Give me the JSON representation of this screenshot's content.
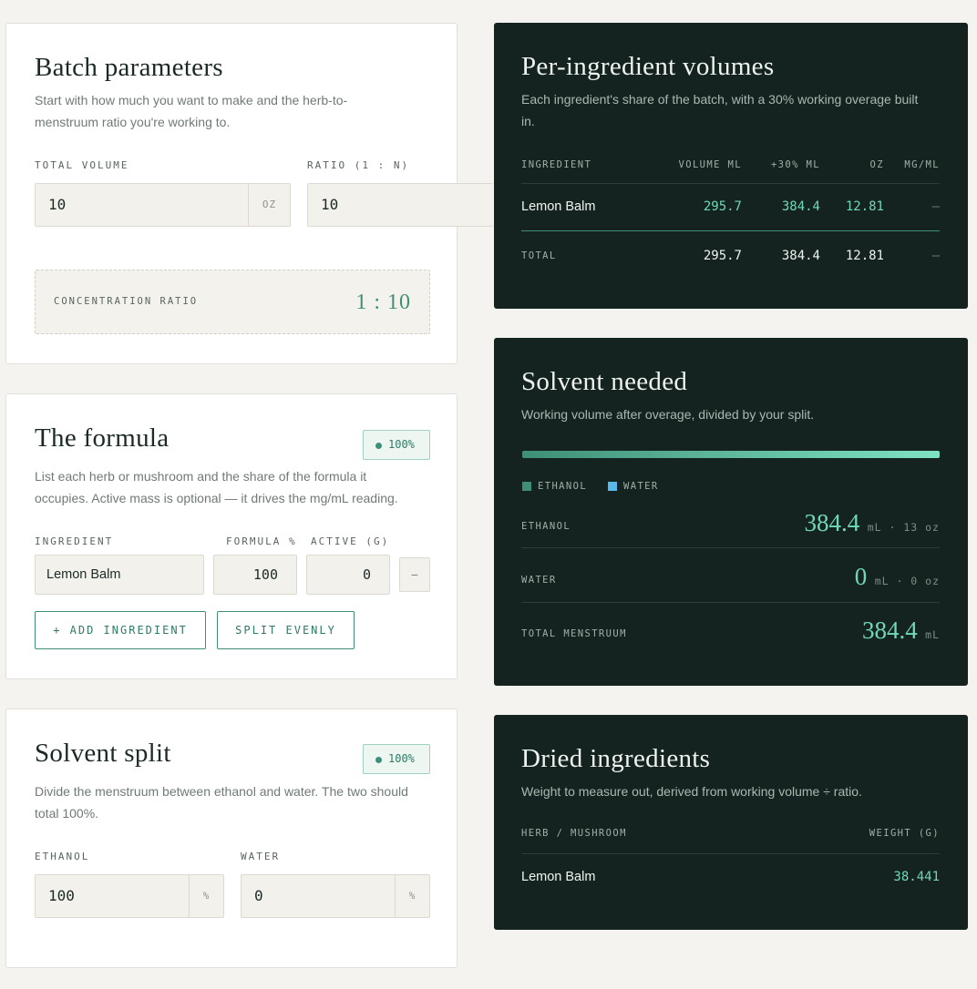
{
  "batch": {
    "title": "Batch parameters",
    "description_line1": "Start with how much you want to make and the herb-to-",
    "description_line2": "menstruum ratio you're working to.",
    "total_volume_label": "TOTAL VOLUME",
    "total_volume_value": "10",
    "total_volume_unit": "OZ",
    "ratio_label": "RATIO (1 : N)",
    "ratio_value": "10",
    "concentration_label": "CONCENTRATION RATIO",
    "concentration_value": "1 : 10"
  },
  "formula": {
    "title": "The formula",
    "badge": "100%",
    "description_line1": "List each herb or mushroom and the share of the formula it",
    "description_line2": "occupies. Active mass is optional — it drives the mg/mL reading.",
    "col_ingredient": "INGREDIENT",
    "col_percent": "FORMULA %",
    "col_active": "ACTIVE (G)",
    "row": {
      "ingredient": "Lemon Balm",
      "percent": "100",
      "active": "0",
      "remove": "−"
    },
    "add_button": "+ ADD INGREDIENT",
    "split_button": "SPLIT EVENLY"
  },
  "solvent_split": {
    "title": "Solvent split",
    "badge": "100%",
    "description_line1": "Divide the menstruum between ethanol and water. The two should",
    "description_line2": "total 100%.",
    "ethanol_label": "ETHANOL",
    "ethanol_value": "100",
    "ethanol_unit": "%",
    "water_label": "WATER",
    "water_value": "0",
    "water_unit": "%"
  },
  "volumes": {
    "title": "Per-ingredient volumes",
    "description_line1": "Each ingredient's share of the batch, with a 30% working overage built",
    "description_line2": "in.",
    "headers": [
      "INGREDIENT",
      "VOLUME ML",
      "+30% ML",
      "OZ",
      "MG/ML"
    ],
    "rows": [
      {
        "ingredient": "Lemon Balm",
        "volume": "295.7",
        "overage": "384.4",
        "oz": "12.81",
        "mgml": "—"
      }
    ],
    "total": {
      "label": "TOTAL",
      "volume": "295.7",
      "overage": "384.4",
      "oz": "12.81",
      "mgml": "—"
    }
  },
  "solvent_needed": {
    "title": "Solvent needed",
    "description": "Working volume after overage, divided by your split.",
    "ethanol_fraction": 1.0,
    "legend_ethanol": "ETHANOL",
    "legend_water": "WATER",
    "ethanol_label": "ETHANOL",
    "ethanol_value": "384.4",
    "ethanol_unit": "mL · 13 oz",
    "water_label": "WATER",
    "water_value": "0",
    "water_unit": "mL · 0 oz",
    "total_label": "TOTAL MENSTRUUM",
    "total_value": "384.4",
    "total_unit": "mL",
    "colors": {
      "ethanol": "#3f8f78",
      "water": "#5ab8e8"
    }
  },
  "dried": {
    "title": "Dried ingredients",
    "description": "Weight to measure out, derived from working volume ÷ ratio.",
    "col_herb": "HERB / MUSHROOM",
    "col_weight": "WEIGHT (G)",
    "rows": [
      {
        "herb": "Lemon Balm",
        "weight": "38.441"
      }
    ]
  }
}
